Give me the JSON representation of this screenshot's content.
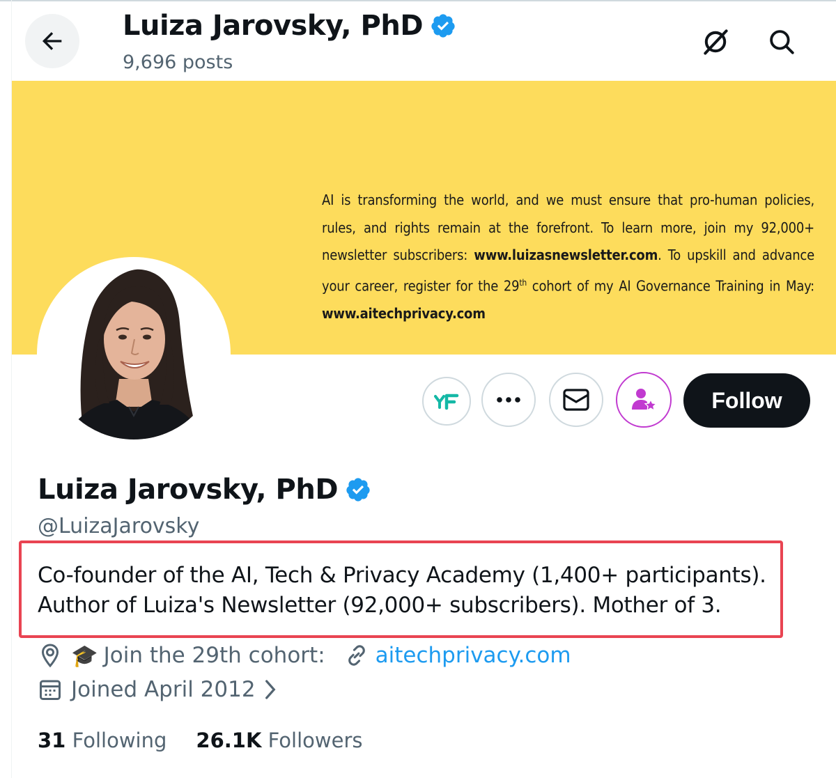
{
  "header": {
    "name": "Luiza Jarovsky, PhD",
    "posts_count": "9,696 posts"
  },
  "banner": {
    "text_1": "AI is transforming the world, and we must ensure that pro-human policies, rules, and rights remain at the forefront. To learn more, join my 92,000+ newsletter subscribers: ",
    "link_1": "www.luizasnewsletter.com",
    "text_2": ". To upskill and advance your career, register for the 29",
    "sup": "th",
    "text_3": " cohort of my AI Governance Training in May: ",
    "link_2": "www.aitechprivacy.com"
  },
  "actions": {
    "follow_label": "Follow"
  },
  "profile": {
    "name": "Luiza Jarovsky, PhD",
    "handle": "@LuizaJarovsky",
    "bio_line_1": "Co-founder of the AI, Tech & Privacy Academy (1,400+ participants).",
    "bio_line_2": "Author of Luiza's Newsletter (92,000+ subscribers). Mother of 3.",
    "location_emoji": "🎓",
    "location": "Join the 29th cohort:",
    "website": "aitechprivacy.com",
    "joined": "Joined April 2012"
  },
  "stats": {
    "following_count": "31",
    "following_label": "Following",
    "followers_count": "26.1K",
    "followers_label": "Followers"
  },
  "colors": {
    "banner": "#fddc5c",
    "verified": "#1d9bf0",
    "highlight_box": "#e94452",
    "subscribe_accent": "#c13ad0",
    "extension_accent": "#14b8a6"
  },
  "icons": [
    "back-arrow-icon",
    "verified-badge-icon",
    "grok-icon",
    "search-icon",
    "extension-icon",
    "more-icon",
    "message-icon",
    "subscribe-icon",
    "location-icon",
    "link-icon",
    "calendar-icon",
    "chevron-right-icon"
  ]
}
